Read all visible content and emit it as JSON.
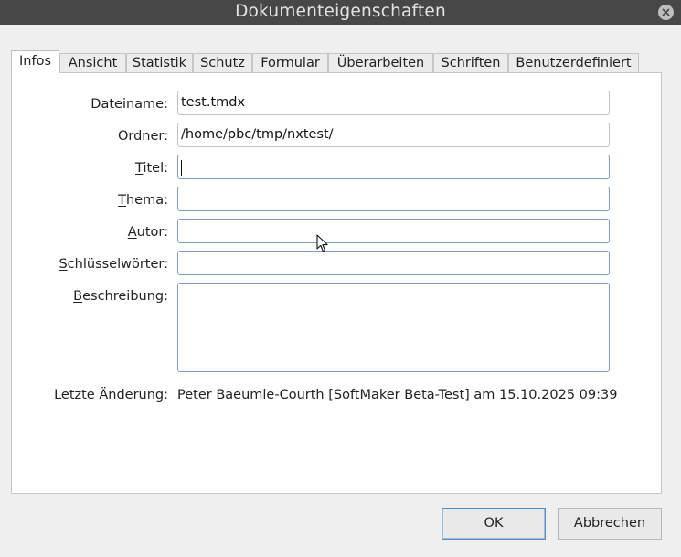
{
  "window": {
    "title": "Dokumenteigenschaften"
  },
  "tabs": [
    {
      "label": "Infos",
      "active": true
    },
    {
      "label": "Ansicht",
      "active": false
    },
    {
      "label": "Statistik",
      "active": false
    },
    {
      "label": "Schutz",
      "active": false
    },
    {
      "label": "Formular",
      "active": false
    },
    {
      "label": "Überarbeiten",
      "active": false
    },
    {
      "label": "Schriften",
      "active": false
    },
    {
      "label": "Benutzerdefiniert",
      "active": false
    }
  ],
  "form": {
    "filename": {
      "label": "Dateiname:",
      "value": "test.tmdx"
    },
    "folder": {
      "label": "Ordner:",
      "value": "/home/pbc/tmp/nxtest/"
    },
    "title": {
      "label_mnemonic": "T",
      "label_rest": "itel:",
      "value": ""
    },
    "subject": {
      "label_mnemonic": "T",
      "label_rest": "hema:",
      "value": ""
    },
    "author": {
      "label_mnemonic": "A",
      "label_rest": "utor:",
      "value": ""
    },
    "keywords": {
      "label_mnemonic": "S",
      "label_rest": "chlüsselwörter:",
      "value": ""
    },
    "description": {
      "label_mnemonic": "B",
      "label_rest": "eschreibung:",
      "value": ""
    }
  },
  "last_modified": {
    "label": "Letzte Änderung:",
    "value": "Peter Baeumle-Courth [SoftMaker Beta-Test] am 15.10.2025 09:39"
  },
  "buttons": {
    "ok": "OK",
    "cancel": "Abbrechen"
  },
  "icons": {
    "close": "close-icon",
    "cursor": "mouse-pointer-icon"
  },
  "colors": {
    "titlebar": "#474747",
    "focus_border": "#7d9fc4",
    "default_button_border": "#5a8cc2"
  }
}
